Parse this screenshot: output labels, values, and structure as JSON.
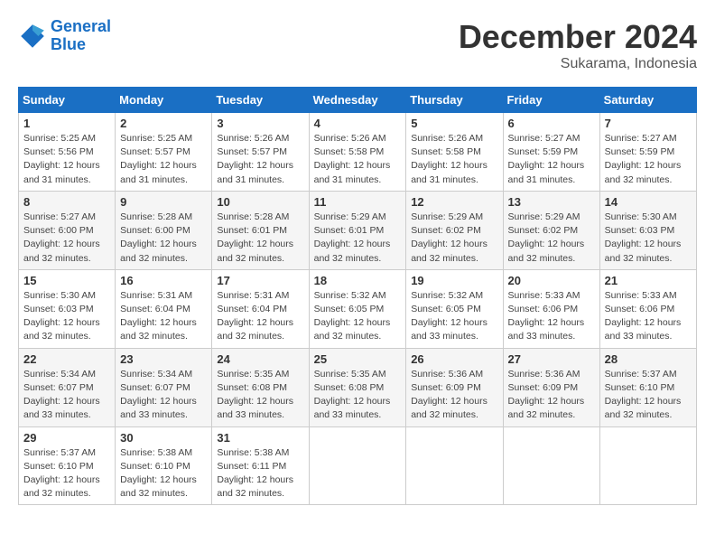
{
  "header": {
    "logo_line1": "General",
    "logo_line2": "Blue",
    "month_title": "December 2024",
    "subtitle": "Sukarama, Indonesia"
  },
  "weekdays": [
    "Sunday",
    "Monday",
    "Tuesday",
    "Wednesday",
    "Thursday",
    "Friday",
    "Saturday"
  ],
  "weeks": [
    [
      {
        "day": "1",
        "sunrise": "5:25 AM",
        "sunset": "5:56 PM",
        "daylight": "12 hours and 31 minutes."
      },
      {
        "day": "2",
        "sunrise": "5:25 AM",
        "sunset": "5:57 PM",
        "daylight": "12 hours and 31 minutes."
      },
      {
        "day": "3",
        "sunrise": "5:26 AM",
        "sunset": "5:57 PM",
        "daylight": "12 hours and 31 minutes."
      },
      {
        "day": "4",
        "sunrise": "5:26 AM",
        "sunset": "5:58 PM",
        "daylight": "12 hours and 31 minutes."
      },
      {
        "day": "5",
        "sunrise": "5:26 AM",
        "sunset": "5:58 PM",
        "daylight": "12 hours and 31 minutes."
      },
      {
        "day": "6",
        "sunrise": "5:27 AM",
        "sunset": "5:59 PM",
        "daylight": "12 hours and 31 minutes."
      },
      {
        "day": "7",
        "sunrise": "5:27 AM",
        "sunset": "5:59 PM",
        "daylight": "12 hours and 32 minutes."
      }
    ],
    [
      {
        "day": "8",
        "sunrise": "5:27 AM",
        "sunset": "6:00 PM",
        "daylight": "12 hours and 32 minutes."
      },
      {
        "day": "9",
        "sunrise": "5:28 AM",
        "sunset": "6:00 PM",
        "daylight": "12 hours and 32 minutes."
      },
      {
        "day": "10",
        "sunrise": "5:28 AM",
        "sunset": "6:01 PM",
        "daylight": "12 hours and 32 minutes."
      },
      {
        "day": "11",
        "sunrise": "5:29 AM",
        "sunset": "6:01 PM",
        "daylight": "12 hours and 32 minutes."
      },
      {
        "day": "12",
        "sunrise": "5:29 AM",
        "sunset": "6:02 PM",
        "daylight": "12 hours and 32 minutes."
      },
      {
        "day": "13",
        "sunrise": "5:29 AM",
        "sunset": "6:02 PM",
        "daylight": "12 hours and 32 minutes."
      },
      {
        "day": "14",
        "sunrise": "5:30 AM",
        "sunset": "6:03 PM",
        "daylight": "12 hours and 32 minutes."
      }
    ],
    [
      {
        "day": "15",
        "sunrise": "5:30 AM",
        "sunset": "6:03 PM",
        "daylight": "12 hours and 32 minutes."
      },
      {
        "day": "16",
        "sunrise": "5:31 AM",
        "sunset": "6:04 PM",
        "daylight": "12 hours and 32 minutes."
      },
      {
        "day": "17",
        "sunrise": "5:31 AM",
        "sunset": "6:04 PM",
        "daylight": "12 hours and 32 minutes."
      },
      {
        "day": "18",
        "sunrise": "5:32 AM",
        "sunset": "6:05 PM",
        "daylight": "12 hours and 32 minutes."
      },
      {
        "day": "19",
        "sunrise": "5:32 AM",
        "sunset": "6:05 PM",
        "daylight": "12 hours and 33 minutes."
      },
      {
        "day": "20",
        "sunrise": "5:33 AM",
        "sunset": "6:06 PM",
        "daylight": "12 hours and 33 minutes."
      },
      {
        "day": "21",
        "sunrise": "5:33 AM",
        "sunset": "6:06 PM",
        "daylight": "12 hours and 33 minutes."
      }
    ],
    [
      {
        "day": "22",
        "sunrise": "5:34 AM",
        "sunset": "6:07 PM",
        "daylight": "12 hours and 33 minutes."
      },
      {
        "day": "23",
        "sunrise": "5:34 AM",
        "sunset": "6:07 PM",
        "daylight": "12 hours and 33 minutes."
      },
      {
        "day": "24",
        "sunrise": "5:35 AM",
        "sunset": "6:08 PM",
        "daylight": "12 hours and 33 minutes."
      },
      {
        "day": "25",
        "sunrise": "5:35 AM",
        "sunset": "6:08 PM",
        "daylight": "12 hours and 33 minutes."
      },
      {
        "day": "26",
        "sunrise": "5:36 AM",
        "sunset": "6:09 PM",
        "daylight": "12 hours and 32 minutes."
      },
      {
        "day": "27",
        "sunrise": "5:36 AM",
        "sunset": "6:09 PM",
        "daylight": "12 hours and 32 minutes."
      },
      {
        "day": "28",
        "sunrise": "5:37 AM",
        "sunset": "6:10 PM",
        "daylight": "12 hours and 32 minutes."
      }
    ],
    [
      {
        "day": "29",
        "sunrise": "5:37 AM",
        "sunset": "6:10 PM",
        "daylight": "12 hours and 32 minutes."
      },
      {
        "day": "30",
        "sunrise": "5:38 AM",
        "sunset": "6:10 PM",
        "daylight": "12 hours and 32 minutes."
      },
      {
        "day": "31",
        "sunrise": "5:38 AM",
        "sunset": "6:11 PM",
        "daylight": "12 hours and 32 minutes."
      },
      null,
      null,
      null,
      null
    ]
  ]
}
